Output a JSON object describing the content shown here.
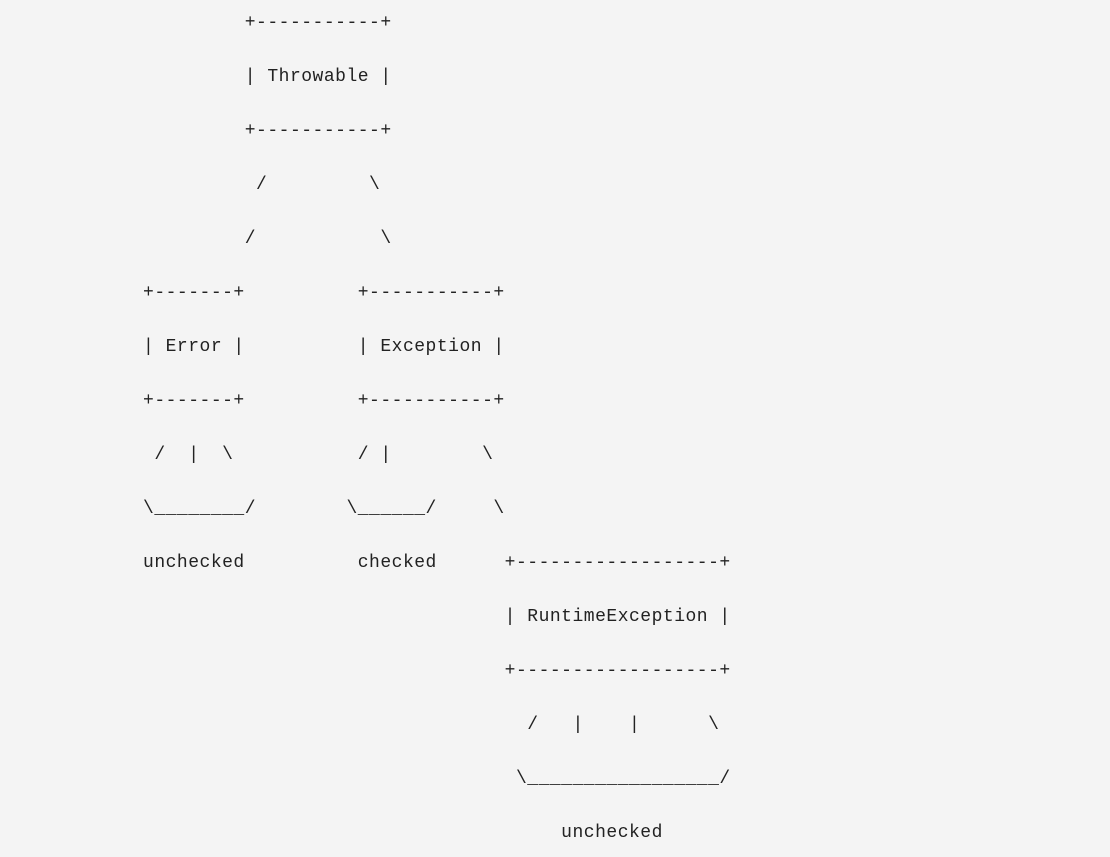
{
  "diagram": {
    "lines": [
      "                   +-----------+",
      "                   | Throwable |",
      "                   +-----------+",
      "                    /         \\",
      "                   /           \\",
      "          +-------+          +-----------+",
      "          | Error |          | Exception |",
      "          +-------+          +-----------+",
      "           /  |  \\           / |        \\",
      "          \\________/        \\______/     \\",
      "          unchecked          checked      +------------------+",
      "                                          | RuntimeException |",
      "                                          +------------------+",
      "                                            /   |    |      \\",
      "                                           \\_________________/",
      "                                               unchecked"
    ],
    "nodes": {
      "root": "Throwable",
      "left": "Error",
      "right": "Exception",
      "right_child": "RuntimeException"
    },
    "labels": {
      "error_type": "unchecked",
      "exception_type": "checked",
      "runtime_exception_type": "unchecked"
    }
  }
}
